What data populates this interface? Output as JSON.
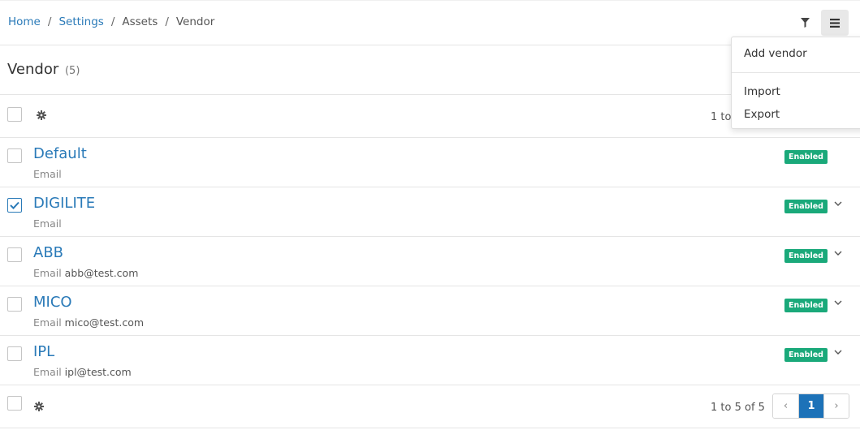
{
  "breadcrumb": {
    "home": "Home",
    "settings": "Settings",
    "assets": "Assets",
    "vendor": "Vendor",
    "separator": "/"
  },
  "header": {
    "filter_icon": "filter-icon",
    "menu_icon": "hamburger-menu-icon"
  },
  "page": {
    "title": "Vendor",
    "count": "(5)"
  },
  "toolbar": {
    "range_text": "1 to 5 of 5",
    "gear_icon": "gear-icon"
  },
  "rows": [
    {
      "name": "Default",
      "label": "Email",
      "email": "",
      "status": "Enabled",
      "checked": false,
      "expandable": false
    },
    {
      "name": "DIGILITE",
      "label": "Email",
      "email": "",
      "status": "Enabled",
      "checked": true,
      "expandable": true
    },
    {
      "name": "ABB",
      "label": "Email",
      "email": "abb@test.com",
      "status": "Enabled",
      "checked": false,
      "expandable": true
    },
    {
      "name": "MICO",
      "label": "Email",
      "email": "mico@test.com",
      "status": "Enabled",
      "checked": false,
      "expandable": true
    },
    {
      "name": "IPL",
      "label": "Email",
      "email": "ipl@test.com",
      "status": "Enabled",
      "checked": false,
      "expandable": true
    }
  ],
  "footer": {
    "range_text": "1 to 5 of 5",
    "prev": "‹",
    "current_page": "1",
    "next": "›"
  },
  "dropdown": {
    "add_vendor": "Add vendor",
    "import": "Import",
    "export": "Export"
  },
  "colors": {
    "link": "#2a7ab8",
    "badge": "#1aa97a",
    "active_page": "#1d72b8"
  }
}
